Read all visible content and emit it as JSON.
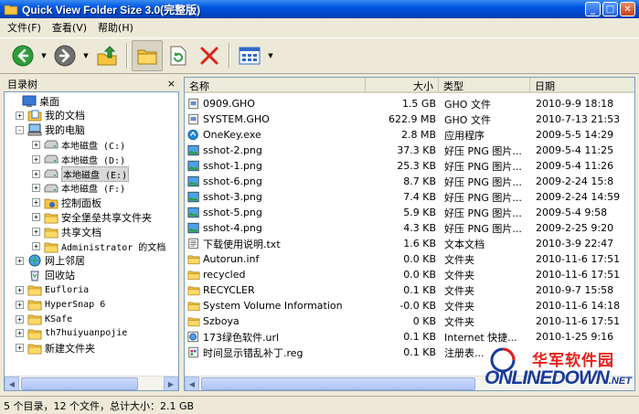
{
  "window": {
    "title": "Quick View Folder Size 3.0(完整版)"
  },
  "menu": {
    "items": [
      "文件(F)",
      "查看(V)",
      "帮助(H)"
    ]
  },
  "toolbar": {
    "icons": [
      "back-icon",
      "forward-icon",
      "up-folder-icon",
      "folders-icon",
      "refresh-icon",
      "delete-icon",
      "view-icon"
    ]
  },
  "tree": {
    "header": "目录树",
    "close": "×",
    "items": [
      {
        "label": "桌面",
        "icon": "desktop-icon"
      },
      {
        "label": "我的文档",
        "icon": "documents-icon"
      },
      {
        "label": "我的电脑",
        "icon": "computer-icon"
      },
      {
        "label": "本地磁盘 (C:)",
        "icon": "drive-icon"
      },
      {
        "label": "本地磁盘 (D:)",
        "icon": "drive-icon"
      },
      {
        "label": "本地磁盘 (E:)",
        "icon": "drive-icon"
      },
      {
        "label": "本地磁盘 (F:)",
        "icon": "drive-icon"
      },
      {
        "label": "控制面板",
        "icon": "control-panel-icon"
      },
      {
        "label": "安全堡垒共享文件夹",
        "icon": "folder-icon"
      },
      {
        "label": "共享文档",
        "icon": "folder-icon"
      },
      {
        "label": "Administrator 的文档",
        "icon": "folder-icon"
      },
      {
        "label": "网上邻居",
        "icon": "network-icon"
      },
      {
        "label": "回收站",
        "icon": "recycle-bin-icon"
      },
      {
        "label": "Eufloria",
        "icon": "folder-icon"
      },
      {
        "label": "HyperSnap 6",
        "icon": "folder-icon"
      },
      {
        "label": "KSafe",
        "icon": "folder-icon"
      },
      {
        "label": "th7huiyuanpojie",
        "icon": "folder-icon"
      },
      {
        "label": "新建文件夹",
        "icon": "folder-icon"
      }
    ]
  },
  "list": {
    "columns": [
      "名称",
      "大小",
      "类型",
      "日期"
    ],
    "rows": [
      {
        "name": "0909.GHO",
        "size": "1.5 GB",
        "type": "GHO 文件",
        "date": "2010-9-9 18:18",
        "icon": "file-icon"
      },
      {
        "name": "SYSTEM.GHO",
        "size": "622.9 MB",
        "type": "GHO 文件",
        "date": "2010-7-13 21:53",
        "icon": "file-icon"
      },
      {
        "name": "OneKey.exe",
        "size": "2.8 MB",
        "type": "应用程序",
        "date": "2009-5-5 14:29",
        "icon": "exe-icon"
      },
      {
        "name": "sshot-2.png",
        "size": "37.3 KB",
        "type": "好压 PNG 图片...",
        "date": "2009-5-4 11:25",
        "icon": "image-icon"
      },
      {
        "name": "sshot-1.png",
        "size": "25.3 KB",
        "type": "好压 PNG 图片...",
        "date": "2009-5-4 11:26",
        "icon": "image-icon"
      },
      {
        "name": "sshot-6.png",
        "size": "8.7 KB",
        "type": "好压 PNG 图片...",
        "date": "2009-2-24 15:8",
        "icon": "image-icon"
      },
      {
        "name": "sshot-3.png",
        "size": "7.4 KB",
        "type": "好压 PNG 图片...",
        "date": "2009-2-24 14:59",
        "icon": "image-icon"
      },
      {
        "name": "sshot-5.png",
        "size": "5.9 KB",
        "type": "好压 PNG 图片...",
        "date": "2009-5-4 9:58",
        "icon": "image-icon"
      },
      {
        "name": "sshot-4.png",
        "size": "4.3 KB",
        "type": "好压 PNG 图片...",
        "date": "2009-2-25 9:20",
        "icon": "image-icon"
      },
      {
        "name": "下载使用说明.txt",
        "size": "1.6 KB",
        "type": "文本文档",
        "date": "2010-3-9 22:47",
        "icon": "text-file-icon"
      },
      {
        "name": "Autorun.inf",
        "size": "0.0 KB",
        "type": "文件夹",
        "date": "2010-11-6 17:51",
        "icon": "folder-icon"
      },
      {
        "name": "recycled",
        "size": "0.0 KB",
        "type": "文件夹",
        "date": "2010-11-6 17:51",
        "icon": "folder-icon"
      },
      {
        "name": "RECYCLER",
        "size": "0.1 KB",
        "type": "文件夹",
        "date": "2010-9-7 15:58",
        "icon": "folder-icon"
      },
      {
        "name": "System Volume Information",
        "size": "-0.0 KB",
        "type": "文件夹",
        "date": "2010-11-6 14:18",
        "icon": "folder-icon"
      },
      {
        "name": "Szboya",
        "size": "0 KB",
        "type": "文件夹",
        "date": "2010-11-6 17:51",
        "icon": "folder-icon"
      },
      {
        "name": "173绿色软件.url",
        "size": "0.1 KB",
        "type": "Internet 快捷...",
        "date": "2010-1-25 9:16",
        "icon": "url-icon"
      },
      {
        "name": "时间显示错乱补丁.reg",
        "size": "0.1 KB",
        "type": "注册表...",
        "date": "",
        "icon": "reg-icon"
      }
    ]
  },
  "status": {
    "text": "5 个目录，12 个文件，总计大小：2.1 GB"
  },
  "watermark": {
    "cn": "华军软件园",
    "en": "ONLINEDOWN",
    "suffix": ".NET"
  },
  "colors": {
    "titlebar": "#0054e3",
    "folder": "#f5c542",
    "accent": "#316ac5"
  }
}
